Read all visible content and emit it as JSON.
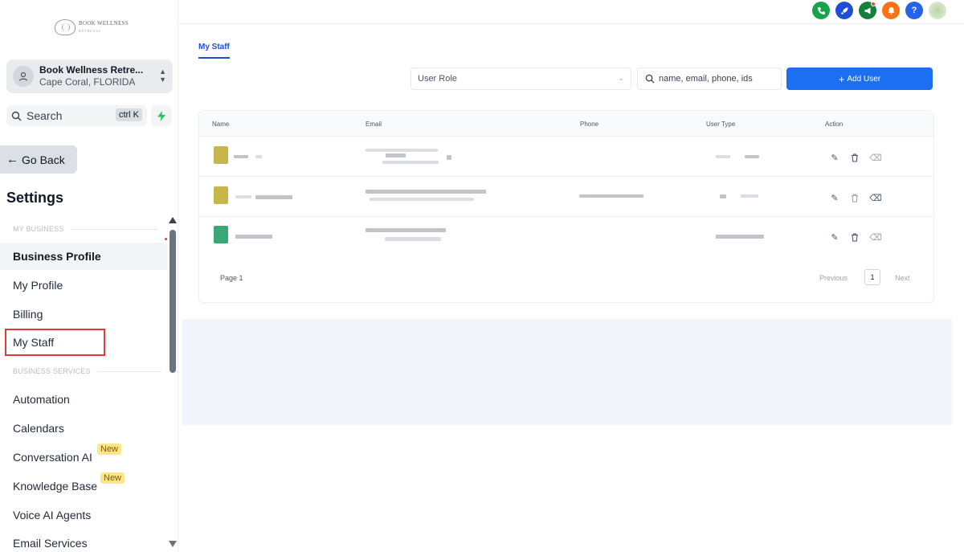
{
  "brand": {
    "logo_text": "BOOK WELLNESS",
    "logo_sub": "RETREATS"
  },
  "location": {
    "name": "Book Wellness Retre...",
    "city": "Cape Coral, FLORIDA"
  },
  "search": {
    "label": "Search",
    "shortcut": "ctrl K"
  },
  "nav": {
    "go_back": "Go Back",
    "settings_title": "Settings",
    "section_my_business": "MY BUSINESS",
    "section_business_services": "BUSINESS SERVICES",
    "business_profile": "Business Profile",
    "my_profile": "My Profile",
    "billing": "Billing",
    "my_staff": "My Staff",
    "automation": "Automation",
    "calendars": "Calendars",
    "conversation_ai": "Conversation AI",
    "knowledge_base": "Knowledge Base",
    "voice_ai_agents": "Voice AI Agents",
    "email_services": "Email Services",
    "badge_new": "New"
  },
  "main": {
    "tab_label": "My Staff",
    "role_placeholder": "User Role",
    "search_placeholder": "name, email, phone, ids",
    "add_user": "Add User",
    "columns": {
      "name": "Name",
      "email": "Email",
      "phone": "Phone",
      "user_type": "User Type",
      "action": "Action"
    },
    "page_label": "Page 1",
    "prev": "Previous",
    "page_number": "1",
    "next": "Next"
  },
  "colors": {
    "accent": "#1d6ff2",
    "highlight_box": "#e03a3a",
    "badge": "#fde68a"
  }
}
